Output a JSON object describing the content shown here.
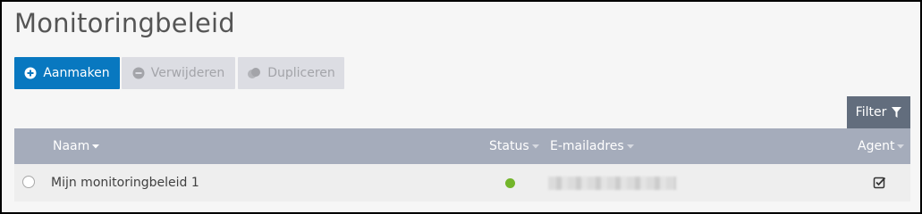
{
  "page": {
    "title": "Monitoringbeleid"
  },
  "toolbar": {
    "create_label": "Aanmaken",
    "delete_label": "Verwijderen",
    "duplicate_label": "Dupliceren",
    "create_icon": "plus-circle-icon",
    "delete_icon": "minus-circle-icon",
    "duplicate_icon": "duplicate-icon"
  },
  "filter": {
    "label": "Filter",
    "icon": "funnel-icon"
  },
  "table": {
    "columns": [
      {
        "label": "Naam",
        "sortable": true
      },
      {
        "label": "Status",
        "sortable": true
      },
      {
        "label": "E-mailadres",
        "sortable": true
      },
      {
        "label": "Agent",
        "sortable": true
      }
    ],
    "rows": [
      {
        "name": "Mijn monitoringbeleid 1",
        "status": "active",
        "status_color": "#73b52a",
        "email": "",
        "email_redacted": true,
        "agent": true
      }
    ]
  },
  "colors": {
    "primary": "#0878c0",
    "disabled_button": "#dcdde3",
    "table_header": "#a5acbb",
    "filter_button": "#626d7d"
  }
}
